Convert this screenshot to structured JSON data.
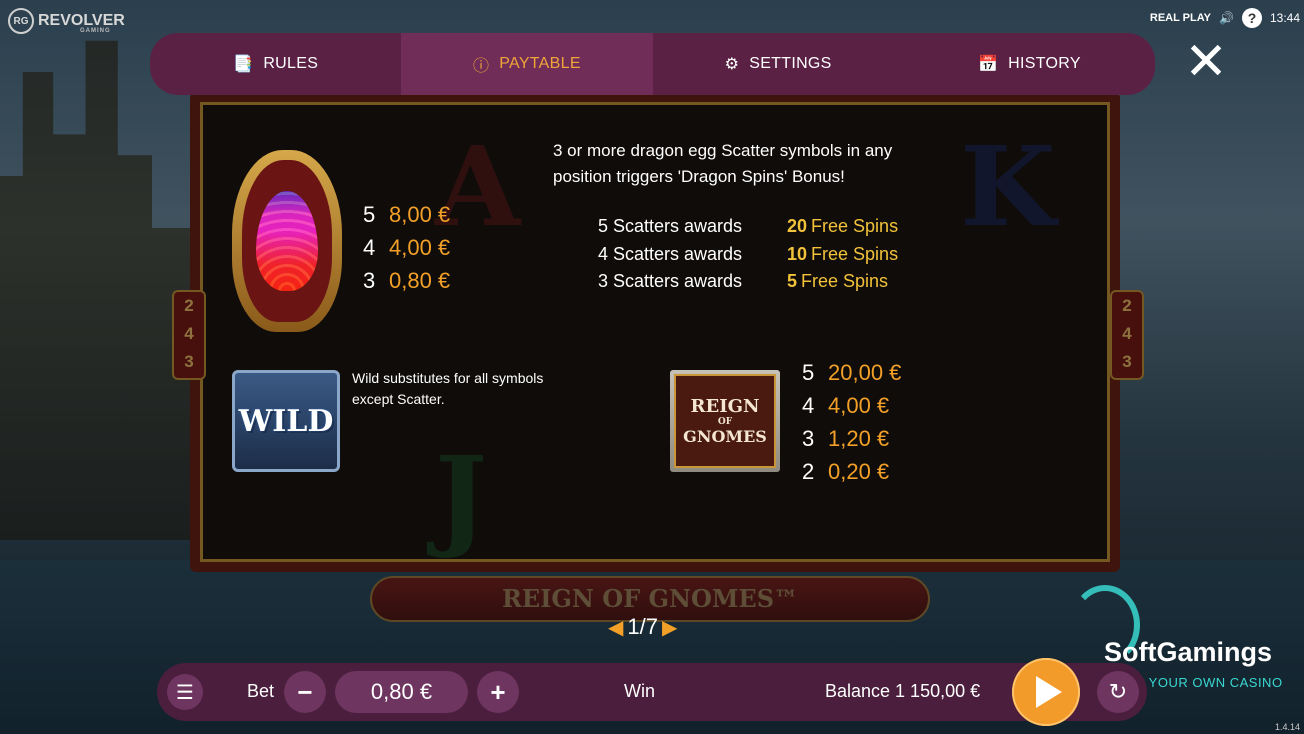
{
  "brand": {
    "badge": "RG",
    "name": "REVOLVER",
    "sub": "GAMING"
  },
  "status": {
    "mode": "REAL PLAY",
    "help": "?",
    "time": "13:44"
  },
  "tabs": [
    {
      "label": "RULES",
      "icon": "rules-icon"
    },
    {
      "label": "PAYTABLE",
      "icon": "info-icon"
    },
    {
      "label": "SETTINGS",
      "icon": "gear-icon"
    },
    {
      "label": "HISTORY",
      "icon": "history-icon"
    }
  ],
  "background": {
    "banner": "REIGN OF GNOMES™",
    "side_numbers": [
      "2",
      "4",
      "3"
    ]
  },
  "egg_payouts": [
    {
      "count": "5",
      "value": "8,00 €"
    },
    {
      "count": "4",
      "value": "4,00 €"
    },
    {
      "count": "3",
      "value": "0,80 €"
    }
  ],
  "wild": {
    "symbol_text": "WILD",
    "description": "Wild substitutes for all symbols except Scatter."
  },
  "scatter": {
    "description": "3 or more dragon egg Scatter symbols in any position triggers 'Dragon Spins' Bonus!",
    "rows": [
      {
        "label": "5 Scatters awards",
        "count": "20",
        "text": "Free Spins"
      },
      {
        "label": "4 Scatters awards",
        "count": "10",
        "text": "Free Spins"
      },
      {
        "label": "3 Scatters awards",
        "count": "5",
        "text": "Free Spins"
      }
    ]
  },
  "reign_symbol": {
    "line1": "REIGN",
    "line2": "OF",
    "line3": "GNOMES"
  },
  "reign_payouts": [
    {
      "count": "5",
      "value": "20,00 €"
    },
    {
      "count": "4",
      "value": "4,00 €"
    },
    {
      "count": "3",
      "value": "1,20 €"
    },
    {
      "count": "2",
      "value": "0,20 €"
    }
  ],
  "pager": {
    "text": "1/7"
  },
  "watermark": {
    "name": "SoftGamings",
    "tagline": "BUILD YOUR OWN CASINO"
  },
  "bottom": {
    "bet_label": "Bet",
    "bet_value": "0,80 €",
    "win_label": "Win",
    "balance": "Balance 1 150,00 €"
  },
  "version": "1.4.14",
  "colors": {
    "accent": "#f2a028",
    "panel": "#5a2145",
    "free_spins": "#f2c23a"
  }
}
